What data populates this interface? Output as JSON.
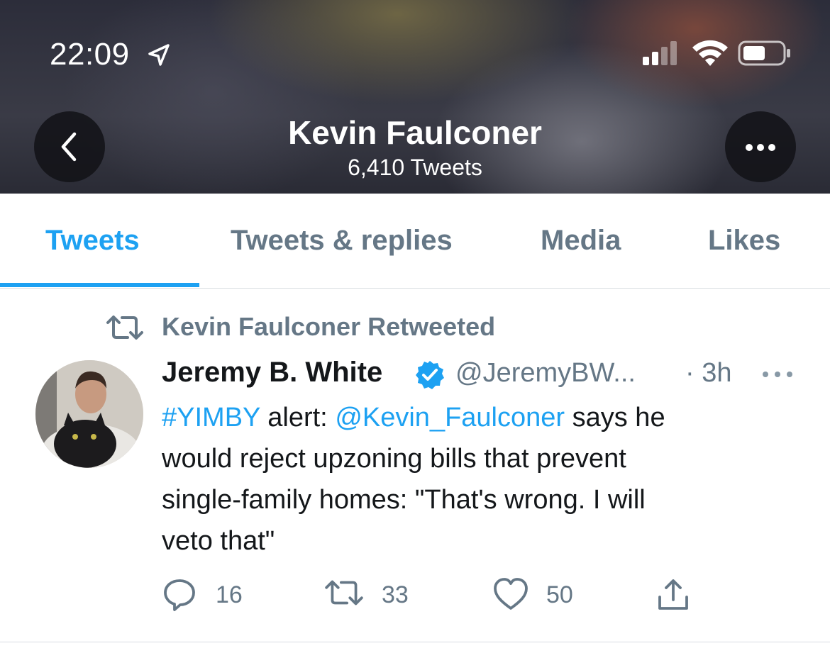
{
  "status_bar": {
    "time": "22:09",
    "icons": [
      "location-arrow-icon",
      "cellular-signal-icon",
      "wifi-icon",
      "battery-icon"
    ]
  },
  "header": {
    "profile_name": "Kevin Faulconer",
    "tweet_count": "6,410 Tweets",
    "back_icon": "chevron-left-icon",
    "more_icon": "ellipsis-icon"
  },
  "tabs": [
    {
      "label": "Tweets",
      "active": true
    },
    {
      "label": "Tweets & replies",
      "active": false
    },
    {
      "label": "Media",
      "active": false
    },
    {
      "label": "Likes",
      "active": false
    }
  ],
  "tweet": {
    "retweet_label": "Kevin Faulconer Retweeted",
    "author_name": "Jeremy B. White",
    "author_handle": "@JeremyBW...",
    "time": "· 3h",
    "body": {
      "hashtag": "#YIMBY",
      "text_after_hashtag": " alert: ",
      "mention": "@Kevin_Faulconer",
      "text_after_mention": " says he",
      "line2": "would reject upzoning bills that prevent",
      "line3": "single-family homes: \"That's wrong. I will",
      "line4": "veto that\""
    },
    "actions": {
      "replies": "16",
      "retweets": "33",
      "likes": "50"
    }
  },
  "colors": {
    "accent": "#1da1f2",
    "muted_text": "#657786",
    "primary_text": "#14171a"
  }
}
